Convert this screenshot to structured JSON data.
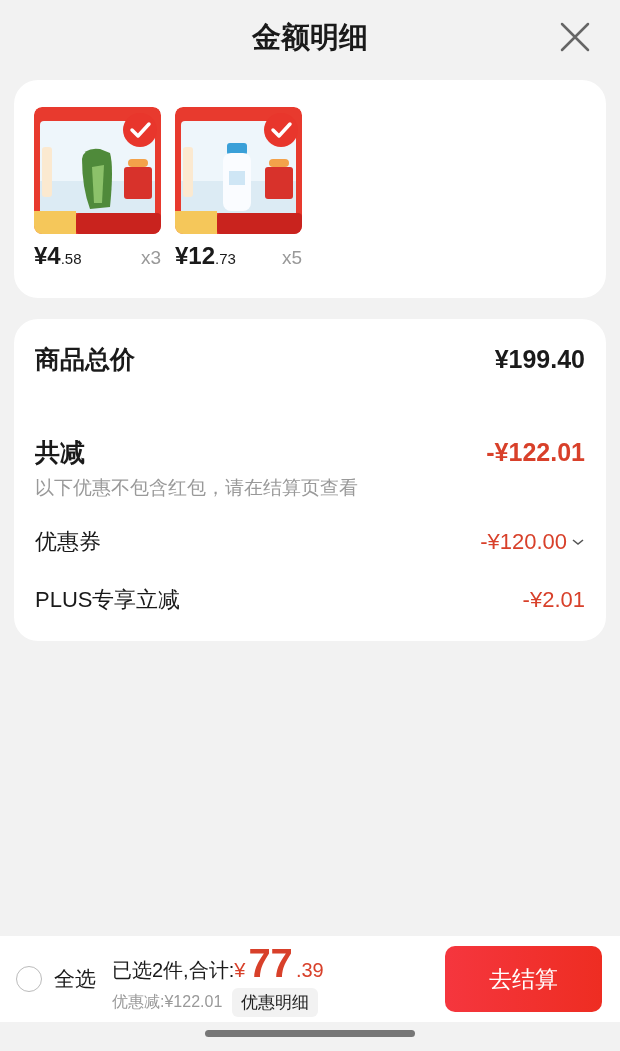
{
  "header": {
    "title": "金额明细"
  },
  "products": [
    {
      "price_main": "¥4",
      "price_decimal": ".58",
      "quantity": "x3",
      "selected": true
    },
    {
      "price_main": "¥12",
      "price_decimal": ".73",
      "quantity": "x5",
      "selected": true
    }
  ],
  "summary": {
    "rows": [
      {
        "kind": "total",
        "label": "商品总价",
        "amount": "¥199.40"
      },
      {
        "kind": "discount_total",
        "label": "共减",
        "amount": "-¥122.01",
        "note": "以下优惠不包含红包，请在结算页查看"
      },
      {
        "kind": "dropdown",
        "label": "优惠券",
        "amount": "-¥120.00",
        "expanded": false
      },
      {
        "kind": "discount",
        "label": "PLUS专享立减",
        "amount": "-¥2.01"
      }
    ]
  },
  "footer": {
    "select_all": {
      "label": "全选",
      "checked": false
    },
    "selected_count": "已选2件,合计:",
    "currency": "¥",
    "total_main": "77",
    "total_decimal": ".39",
    "discount": "优惠减:¥122.01",
    "detail_button": "优惠明细",
    "checkout_button": "去结算"
  }
}
